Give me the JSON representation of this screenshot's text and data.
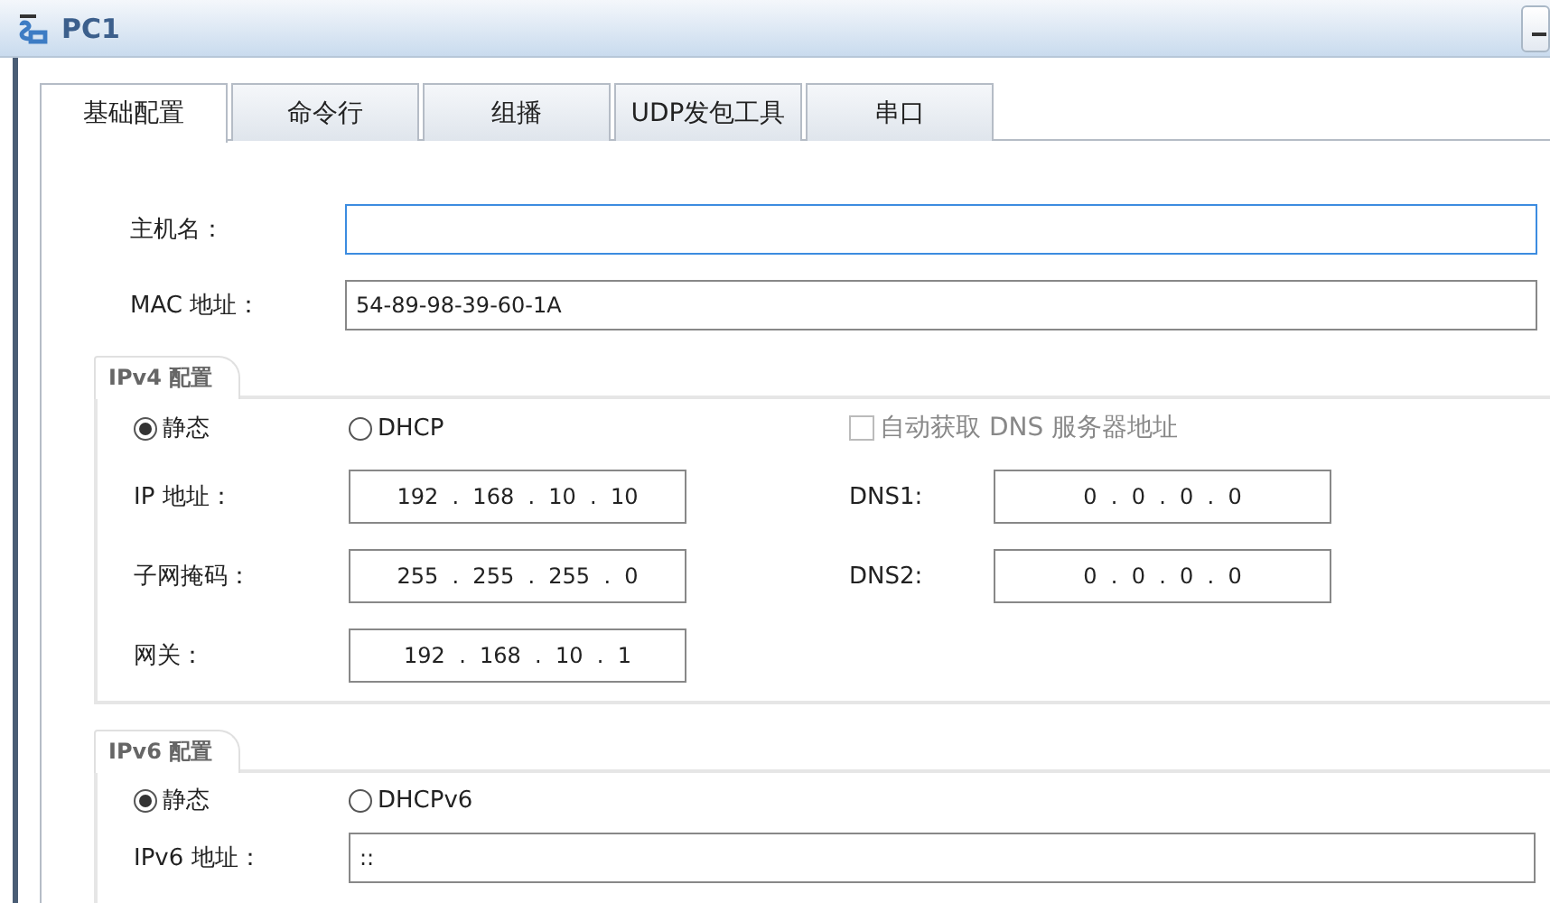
{
  "window": {
    "title": "PC1"
  },
  "tabs": [
    {
      "label": "基础配置",
      "selected": true
    },
    {
      "label": "命令行",
      "selected": false
    },
    {
      "label": "组播",
      "selected": false
    },
    {
      "label": "UDP发包工具",
      "selected": false
    },
    {
      "label": "串口",
      "selected": false
    }
  ],
  "host_name": {
    "label": "主机名：",
    "focused": true
  },
  "mac": {
    "label": "MAC 地址：",
    "value": "54-89-98-39-60-1A"
  },
  "ipv4": {
    "title": "IPv4 配置",
    "modes": [
      {
        "label": "静态",
        "selected": true
      },
      {
        "label": "DHCP",
        "selected": false
      }
    ],
    "auto_dns": {
      "label": "自动获取 DNS 服务器地址",
      "checked": false,
      "disabled": true
    },
    "fields": [
      {
        "label": "IP 地址：",
        "octets": [
          "192",
          "168",
          "10",
          "10"
        ]
      },
      {
        "label": "子网掩码：",
        "octets": [
          "255",
          "255",
          "255",
          "0"
        ]
      },
      {
        "label": "网关：",
        "octets": [
          "192",
          "168",
          "10",
          "1"
        ]
      }
    ],
    "dns": [
      {
        "label": "DNS1:",
        "octets": [
          "0",
          "0",
          "0",
          "0"
        ]
      },
      {
        "label": "DNS2:",
        "octets": [
          "0",
          "0",
          "0",
          "0"
        ]
      }
    ],
    "separator": "."
  },
  "ipv6": {
    "title": "IPv6 配置",
    "modes": [
      {
        "label": "静态",
        "selected": true
      },
      {
        "label": "DHCPv6",
        "selected": false
      }
    ],
    "address": {
      "label": "IPv6 地址：",
      "value": "::"
    }
  }
}
